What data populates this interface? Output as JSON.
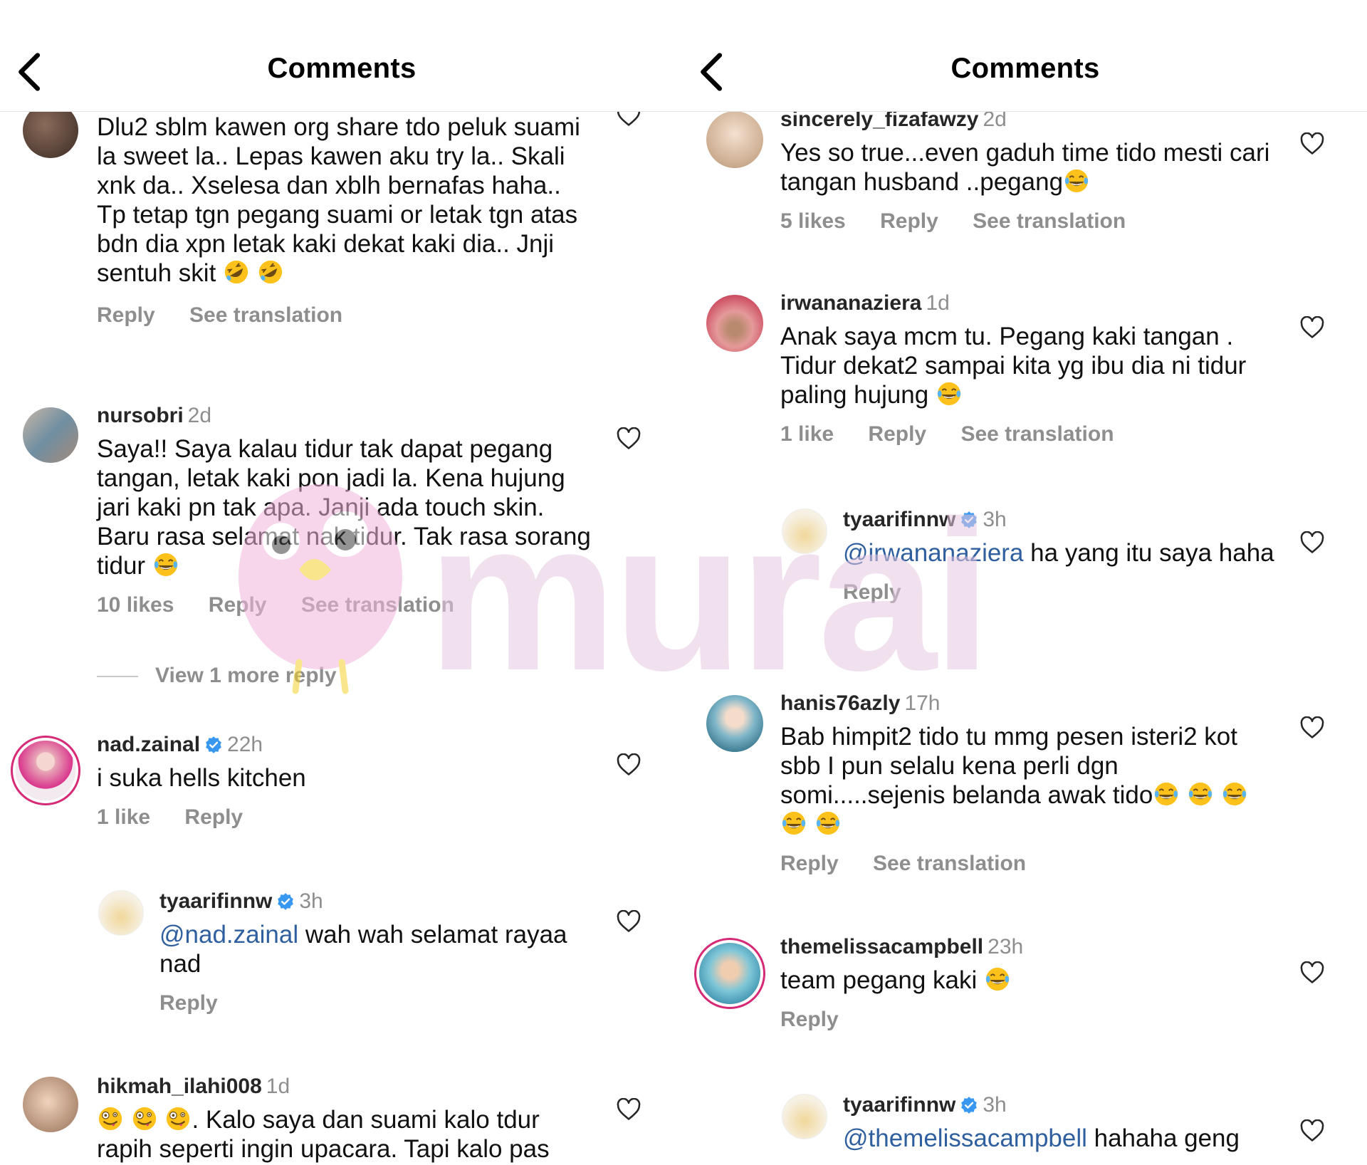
{
  "left": {
    "title": "Comments",
    "comments": [
      {
        "username": "",
        "time": "",
        "text": "Dlu2 sblm kawen org share tdo peluk suami la sweet la.. Lepas kawen aku try la.. Skali xnk da.. Xselesa dan xblh bernafas haha.. Tp tetap tgn pegang suami or letak tgn atas bdn dia xpn letak kaki dekat kaki dia.. Jnji sentuh skit",
        "reply": "Reply",
        "see_translation": "See translation"
      },
      {
        "username": "nursobri",
        "time": "2d",
        "text": "Saya!! Saya kalau tidur tak dapat pegang tangan, letak kaki pon jadi la. Kena hujung jari kaki pn tak apa. Janji ada touch skin. Baru rasa selamat nak tidur. Tak rasa sorang tidur",
        "likes": "10 likes",
        "reply": "Reply",
        "see_translation": "See translation"
      },
      {
        "username": "nad.zainal",
        "time": "22h",
        "text": "i suka hells kitchen",
        "likes": "1 like",
        "reply": "Reply"
      },
      {
        "username": "tyaarifinnw",
        "time": "3h",
        "mention": "@nad.zainal",
        "text": " wah wah selamat rayaa nad",
        "reply": "Reply"
      },
      {
        "username": "hikmah_ilahi008",
        "time": "1d",
        "text": ". Kalo saya dan suami kalo tdur rapih seperti ingin upacara. Tapi kalo pas"
      }
    ],
    "view_more": "View 1 more reply"
  },
  "right": {
    "title": "Comments",
    "comments": [
      {
        "username": "sincerely_fizafawzy",
        "time": "2d",
        "text": "Yes so true...even gaduh time tido mesti cari tangan husband ..pegang",
        "likes": "5 likes",
        "reply": "Reply",
        "see_translation": "See translation"
      },
      {
        "username": "irwananaziera",
        "time": "1d",
        "text": "Anak saya mcm tu. Pegang kaki tangan . Tidur dekat2 sampai kita yg ibu dia ni tidur paling hujung",
        "likes": "1 like",
        "reply": "Reply",
        "see_translation": "See translation"
      },
      {
        "username": "tyaarifinnw",
        "time": "3h",
        "mention": "@irwananaziera",
        "text": " ha yang itu saya haha",
        "reply": "Reply"
      },
      {
        "username": "hanis76azly",
        "time": "17h",
        "text": "Bab himpit2 tido tu mmg pesen isteri2 kot sbb I pun selalu kena perli dgn somi.....sejenis belanda awak tido",
        "reply": "Reply",
        "see_translation": "See translation"
      },
      {
        "username": "themelissacampbell",
        "time": "23h",
        "text": "team pegang kaki",
        "reply": "Reply"
      },
      {
        "username": "tyaarifinnw",
        "time": "3h",
        "mention": "@themelissacampbell",
        "text": " hahaha geng"
      }
    ]
  },
  "watermark": {
    "text": "murai"
  },
  "icons": {
    "back": "chevron-left-icon",
    "like": "heart-outline-icon",
    "verified": "verified-badge-icon",
    "emoji_laugh": "tears-of-joy-emoji",
    "emoji_rofl": "rolling-laughing-emoji",
    "emoji_zany": "zany-face-emoji"
  },
  "colors": {
    "mention": "#2f5f9e",
    "muted": "#8e8e8e",
    "verified": "#3897f0",
    "story_ring": "#d62976",
    "watermark": "#e6c7e0"
  }
}
